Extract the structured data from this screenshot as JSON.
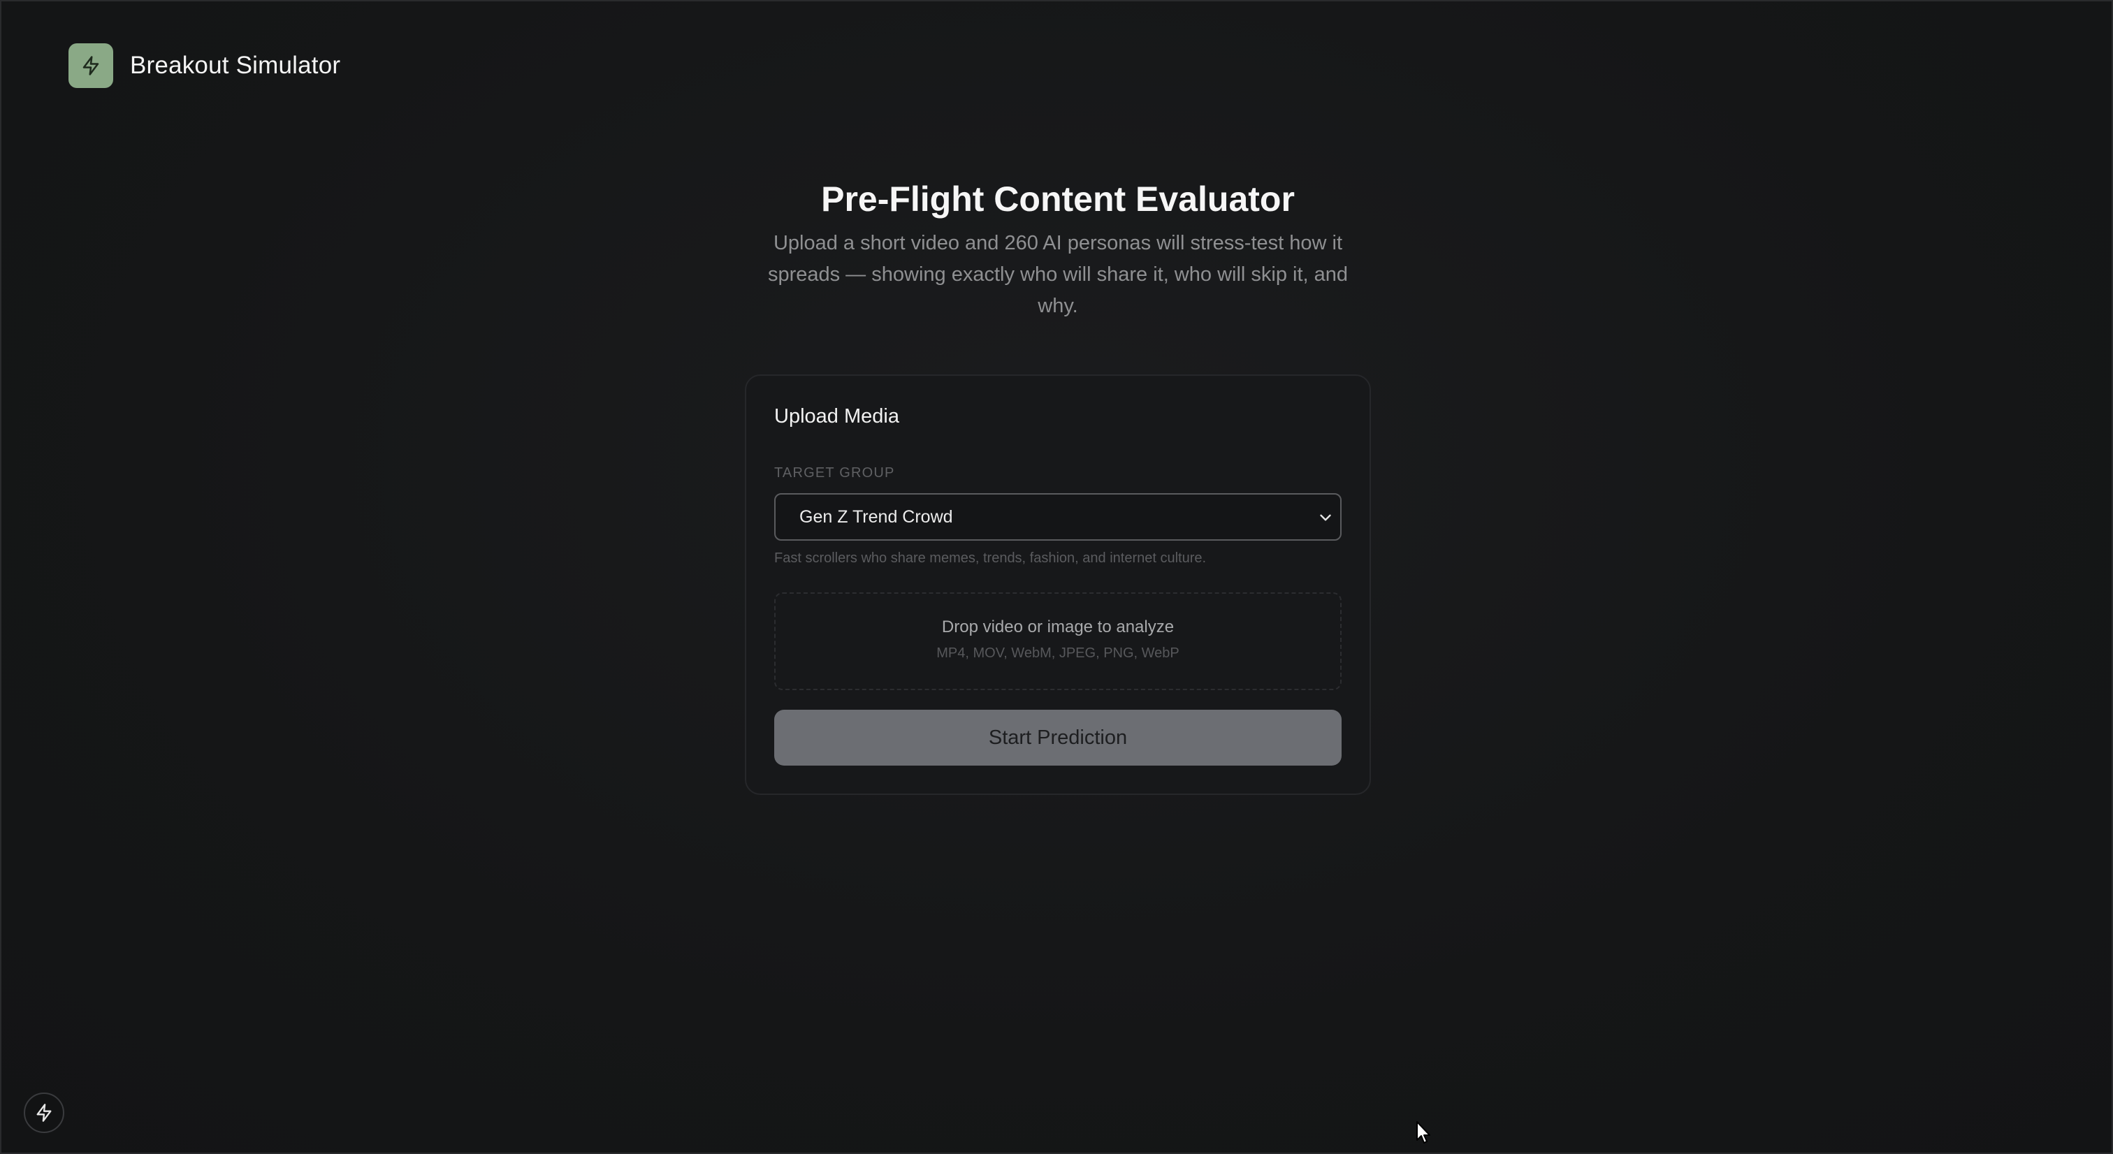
{
  "app": {
    "title": "Breakout Simulator",
    "logo_icon": "bolt-icon",
    "accent_color": "#8aa986"
  },
  "hero": {
    "title": "Pre-Flight Content Evaluator",
    "subtitle": "Upload a short video and 260 AI personas will stress-test how it spreads — showing exactly who will share it, who will skip it, and why."
  },
  "upload_card": {
    "title": "Upload Media",
    "target_group": {
      "label": "TARGET GROUP",
      "selected": "Gen Z Trend Crowd",
      "help": "Fast scrollers who share memes, trends, fashion, and internet culture."
    },
    "dropzone": {
      "title": "Drop video or image to analyze",
      "formats": "MP4, MOV, WebM, JPEG, PNG, WebP"
    },
    "start_button": "Start Prediction"
  },
  "corner_badge_icon": "bolt-icon"
}
